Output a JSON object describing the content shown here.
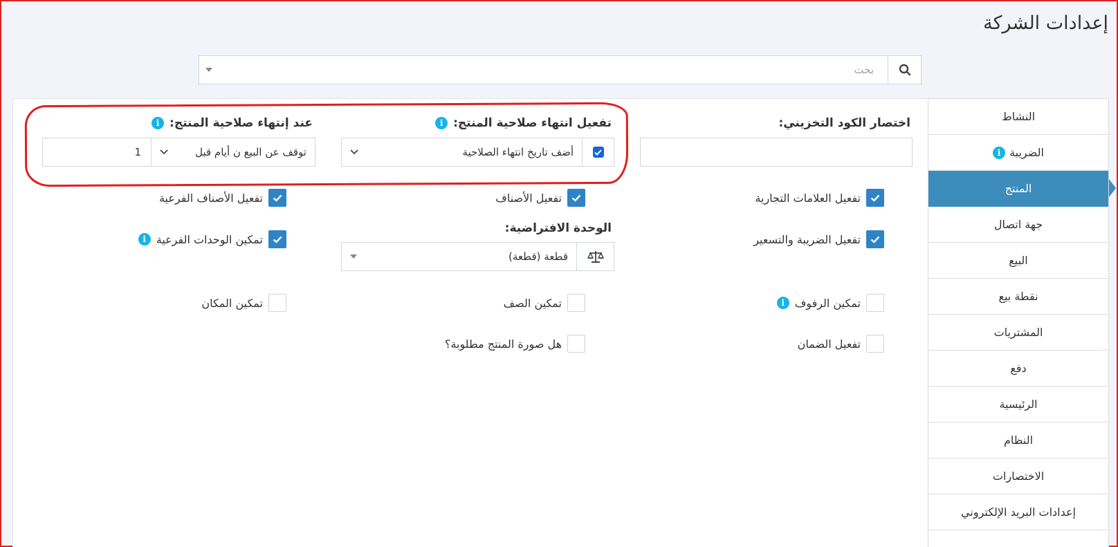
{
  "page": {
    "title": "إعدادات الشركة"
  },
  "search": {
    "placeholder": "بحث"
  },
  "sidebar": {
    "items": [
      {
        "label": "النشاط",
        "active": false,
        "info": false
      },
      {
        "label": "الضريبة",
        "active": false,
        "info": true
      },
      {
        "label": "المنتج",
        "active": true,
        "info": false
      },
      {
        "label": "جهة اتصال",
        "active": false,
        "info": false
      },
      {
        "label": "البيع",
        "active": false,
        "info": false
      },
      {
        "label": "نقطة بيع",
        "active": false,
        "info": false
      },
      {
        "label": "المشتريات",
        "active": false,
        "info": false
      },
      {
        "label": "دفع",
        "active": false,
        "info": false
      },
      {
        "label": "الرئيسية",
        "active": false,
        "info": false
      },
      {
        "label": "النظام",
        "active": false,
        "info": false
      },
      {
        "label": "الاختصارات",
        "active": false,
        "info": false
      },
      {
        "label": "إعدادات البريد الإلكتروني",
        "active": false,
        "info": false
      }
    ]
  },
  "product": {
    "sku_prefix": {
      "label": "اختصار الكود التخزيني:",
      "value": ""
    },
    "enable_expiry": {
      "label": "تفعيل انتهاء صلاحية المنتج:",
      "select_value": "أضف تاريخ انتهاء الصلاحية",
      "checked": true
    },
    "on_expiry": {
      "label": "عند إنتهاء صلاحية المنتج:",
      "select_value": "توقف عن البيع ن أيام قبل",
      "days": "1"
    },
    "enable_brands": {
      "label": "تفعيل العلامات التجارية",
      "checked": true
    },
    "enable_categories": {
      "label": "تفعيل الأصناف",
      "checked": true
    },
    "enable_sub_categories": {
      "label": "تفعيل الأصناف الفرعية",
      "checked": true
    },
    "enable_tax_pricing": {
      "label": "تفعيل الضريبة والتسعير",
      "checked": true
    },
    "default_unit": {
      "label": "الوحدة الافتراضية:",
      "value": "قطعة (قطعة)"
    },
    "enable_sub_units": {
      "label": "تمكين الوحدات الفرعية",
      "checked": true
    },
    "enable_racks": {
      "label": "تمكين الرفوف",
      "checked": false
    },
    "enable_row": {
      "label": "تمكين الصف",
      "checked": false
    },
    "enable_position": {
      "label": "تمكين المكان",
      "checked": false
    },
    "enable_warranty": {
      "label": "تفعيل الضمان",
      "checked": false
    },
    "image_required": {
      "label": "هل صورة المنتج مطلوبة؟",
      "checked": false
    }
  },
  "colors": {
    "accent": "#3c8dbc",
    "checkbox": "#2f84c5",
    "info": "#17b4e6",
    "highlight": "#e01e1e"
  }
}
